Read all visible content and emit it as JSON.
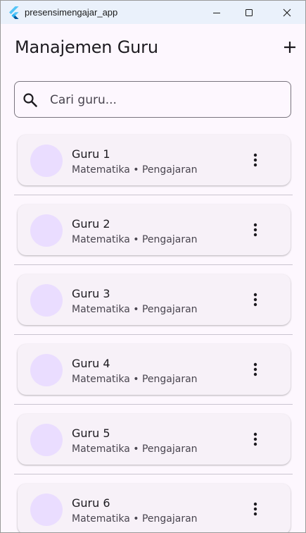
{
  "window": {
    "title": "presensimengajar_app"
  },
  "appbar": {
    "title": "Manajemen Guru",
    "add_icon": "add-icon"
  },
  "search": {
    "placeholder": "Cari guru...",
    "value": ""
  },
  "teachers": [
    {
      "name": "Guru 1",
      "subject": "Matematika",
      "role": "Pengajaran",
      "subtitle": "Matematika • Pengajaran"
    },
    {
      "name": "Guru 2",
      "subject": "Matematika",
      "role": "Pengajaran",
      "subtitle": "Matematika • Pengajaran"
    },
    {
      "name": "Guru 3",
      "subject": "Matematika",
      "role": "Pengajaran",
      "subtitle": "Matematika • Pengajaran"
    },
    {
      "name": "Guru 4",
      "subject": "Matematika",
      "role": "Pengajaran",
      "subtitle": "Matematika • Pengajaran"
    },
    {
      "name": "Guru 5",
      "subject": "Matematika",
      "role": "Pengajaran",
      "subtitle": "Matematika • Pengajaran"
    },
    {
      "name": "Guru 6",
      "subject": "Matematika",
      "role": "Pengajaran",
      "subtitle": "Matematika • Pengajaran"
    }
  ],
  "colors": {
    "background": "#fdf7fe",
    "card": "#f7f1f8",
    "avatar": "#eaddff",
    "titlebar": "#eaf1fb",
    "outline": "#79747e"
  }
}
